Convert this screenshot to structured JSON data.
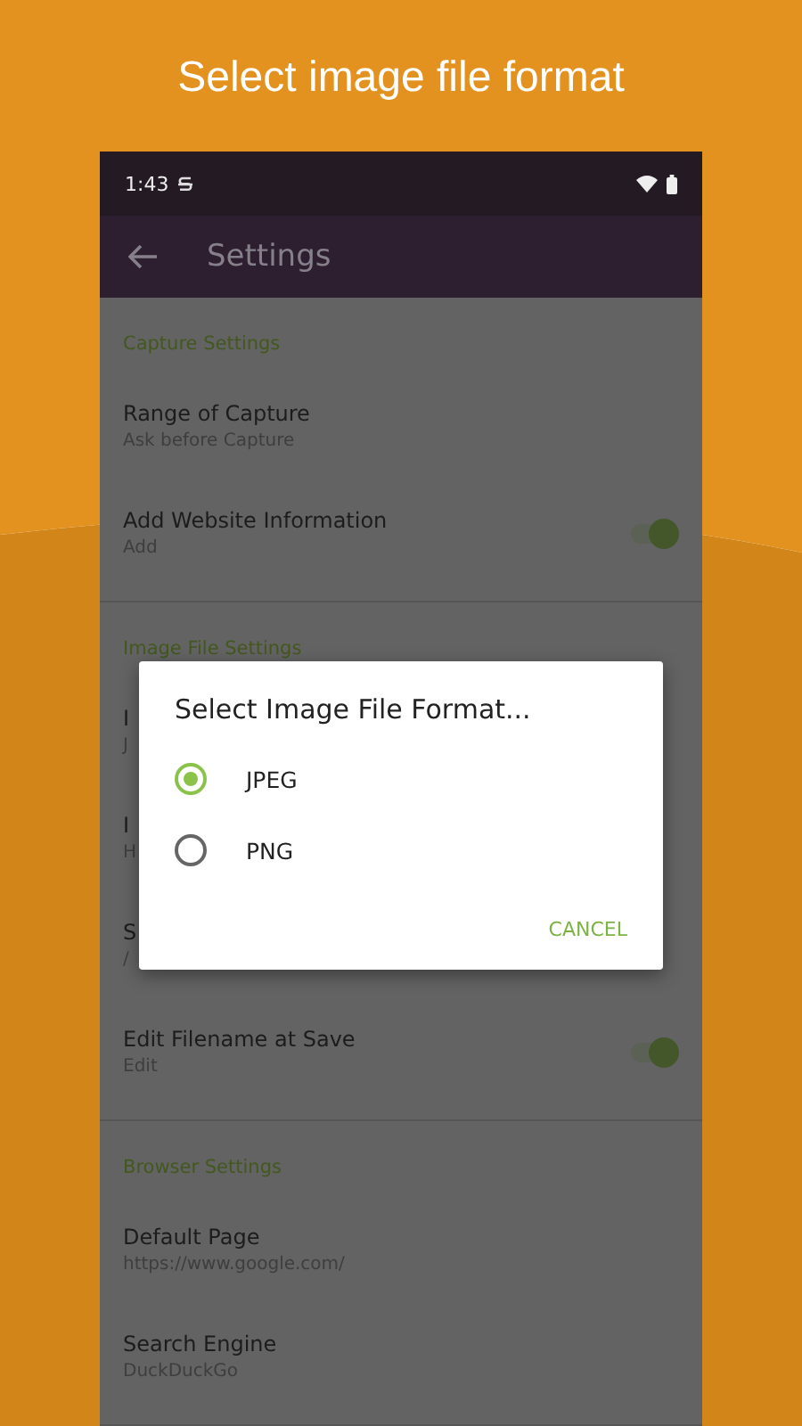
{
  "headline": "Select image file format",
  "status_bar": {
    "time": "1:43"
  },
  "app_bar": {
    "title": "Settings"
  },
  "sections": [
    {
      "header": "Capture Settings",
      "rows": [
        {
          "title": "Range of Capture",
          "summary": "Ask before Capture"
        },
        {
          "title": "Add Website Information",
          "summary": "Add",
          "kind": "switch",
          "on": true
        }
      ]
    },
    {
      "header": "Image File Settings",
      "rows": [
        {
          "title": "I",
          "summary": "J"
        },
        {
          "title": "I",
          "summary": "H"
        },
        {
          "title": "S",
          "summary": "/"
        },
        {
          "title": "Edit Filename at Save",
          "summary": "Edit",
          "kind": "switch",
          "on": true
        }
      ]
    },
    {
      "header": "Browser Settings",
      "rows": [
        {
          "title": "Default Page",
          "summary": "https://www.google.com/"
        },
        {
          "title": "Search Engine",
          "summary": "DuckDuckGo"
        }
      ]
    }
  ],
  "dialog": {
    "title": "Select Image File Format...",
    "options": [
      {
        "label": "JPEG",
        "selected": true
      },
      {
        "label": "PNG",
        "selected": false
      }
    ],
    "button": "CANCEL"
  }
}
